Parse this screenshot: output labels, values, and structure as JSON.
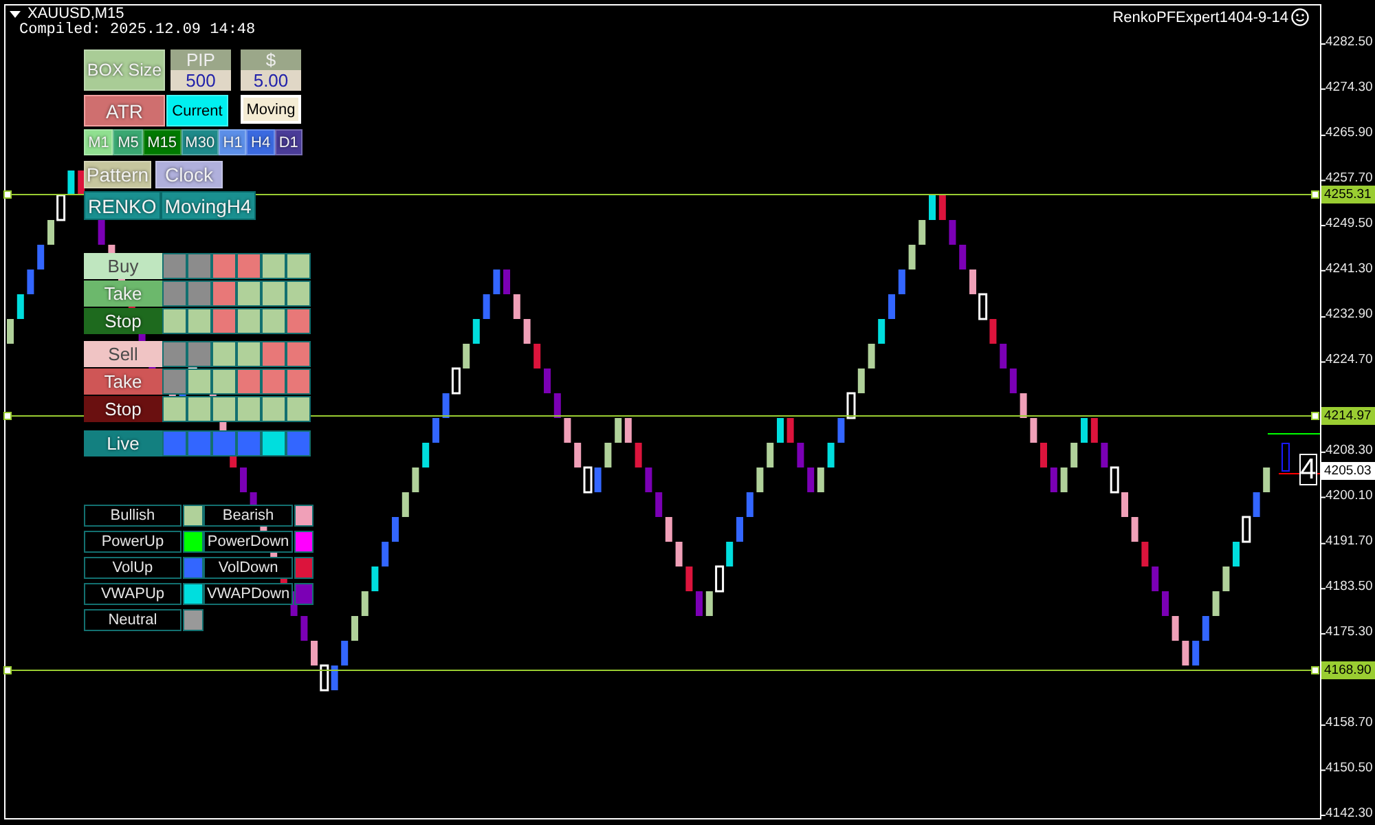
{
  "symbol": {
    "title": "XAUUSD,M15",
    "compiled": "Compiled: 2025.12.09 14:48"
  },
  "expert": {
    "name": "RenkoPFExpert1404-9-14"
  },
  "box_size": {
    "label": "BOX Size",
    "pip_label": "PIP",
    "pip_value": "500",
    "usd_label": "$",
    "usd_value": "5.00"
  },
  "mode_buttons": [
    {
      "label": "ATR",
      "kind": "atr"
    },
    {
      "label": "Current",
      "kind": "current"
    },
    {
      "label": "Moving",
      "kind": "moving"
    }
  ],
  "timeframes": [
    {
      "label": "M1",
      "color": "#90e090"
    },
    {
      "label": "M5",
      "color": "#3aa872"
    },
    {
      "label": "M15",
      "color": "#007a00"
    },
    {
      "label": "M30",
      "color": "#1f8a8a"
    },
    {
      "label": "H1",
      "color": "#5c8fe8"
    },
    {
      "label": "H4",
      "color": "#3b6ae0"
    },
    {
      "label": "D1",
      "color": "#4a3c98"
    }
  ],
  "tool_buttons": [
    {
      "label": "Pattern",
      "color": "#c6c69e"
    },
    {
      "label": "Clock",
      "color": "#b0b0dc"
    }
  ],
  "chart_buttons": [
    {
      "label": "RENKO"
    },
    {
      "label": "MovingH4"
    }
  ],
  "signal_rows": [
    {
      "label": "Buy",
      "color": "#bfe6bf",
      "cells": [
        {
          "color": "#8c8c8c"
        },
        {
          "color": "#8c8c8c"
        },
        {
          "color": "#e87878"
        },
        {
          "color": "#e87878"
        },
        {
          "color": "#b0d19a"
        },
        {
          "color": "#b0d19a"
        }
      ]
    },
    {
      "label": "Take",
      "color": "#6cb86c",
      "cells": [
        {
          "color": "#8c8c8c"
        },
        {
          "color": "#8c8c8c"
        },
        {
          "color": "#e87878"
        },
        {
          "color": "#b0d19a"
        },
        {
          "color": "#b0d19a"
        },
        {
          "color": "#b0d19a"
        }
      ]
    },
    {
      "label": "Stop",
      "color": "#1e6a1e",
      "cells": [
        {
          "color": "#b0d19a"
        },
        {
          "color": "#b0d19a"
        },
        {
          "color": "#e87878"
        },
        {
          "color": "#b0d19a"
        },
        {
          "color": "#b0d19a"
        },
        {
          "color": "#e87878"
        }
      ]
    },
    {
      "label": "Sell",
      "color": "#f0c4c4",
      "cells": [
        {
          "color": "#8c8c8c"
        },
        {
          "color": "#8c8c8c"
        },
        {
          "color": "#b0d19a"
        },
        {
          "color": "#b0d19a"
        },
        {
          "color": "#e87878"
        },
        {
          "color": "#e87878"
        }
      ]
    },
    {
      "label": "Take",
      "color": "#cf5656",
      "cells": [
        {
          "color": "#8c8c8c"
        },
        {
          "color": "#b0d19a"
        },
        {
          "color": "#b0d19a"
        },
        {
          "color": "#e87878"
        },
        {
          "color": "#e87878"
        },
        {
          "color": "#e87878"
        }
      ]
    },
    {
      "label": "Stop",
      "color": "#6a1010",
      "cells": [
        {
          "color": "#b0d19a"
        },
        {
          "color": "#b0d19a"
        },
        {
          "color": "#b0d19a"
        },
        {
          "color": "#b0d19a"
        },
        {
          "color": "#b0d19a"
        },
        {
          "color": "#b0d19a"
        }
      ]
    },
    {
      "label": "Live",
      "color": "#138080",
      "cells": [
        {
          "color": "#3366ff"
        },
        {
          "color": "#3366ff"
        },
        {
          "color": "#3366ff"
        },
        {
          "color": "#3366ff"
        },
        {
          "color": "#00dede"
        },
        {
          "color": "#3366ff"
        }
      ]
    }
  ],
  "legend": [
    {
      "label": "Bullish",
      "color": "#b0d19a"
    },
    {
      "label": "Bearish",
      "color": "#f0a0b8"
    },
    {
      "label": "PowerUp",
      "color": "#00ff00"
    },
    {
      "label": "PowerDown",
      "color": "#ff00ff"
    },
    {
      "label": "VolUp",
      "color": "#3366ff"
    },
    {
      "label": "VolDown",
      "color": "#dc143c"
    },
    {
      "label": "VWAPUp",
      "color": "#00dede"
    },
    {
      "label": "VWAPDown",
      "color": "#7b00b5"
    },
    {
      "label": "Neutral",
      "color": "#999999"
    }
  ],
  "price_axis": [
    "4282.50",
    "4274.30",
    "4265.90",
    "4257.70",
    "4249.50",
    "4241.30",
    "4232.90",
    "4224.70",
    "4208.30",
    "4200.10",
    "4191.70",
    "4183.50",
    "4175.30",
    "4158.70",
    "4150.50",
    "4142.30"
  ],
  "price_lines": [
    {
      "price": "4255.31",
      "kind": "level"
    },
    {
      "price": "4214.97",
      "kind": "level"
    },
    {
      "price": "4205.03",
      "kind": "current"
    },
    {
      "price": "4168.90",
      "kind": "level"
    }
  ],
  "brick_counter": "4"
}
